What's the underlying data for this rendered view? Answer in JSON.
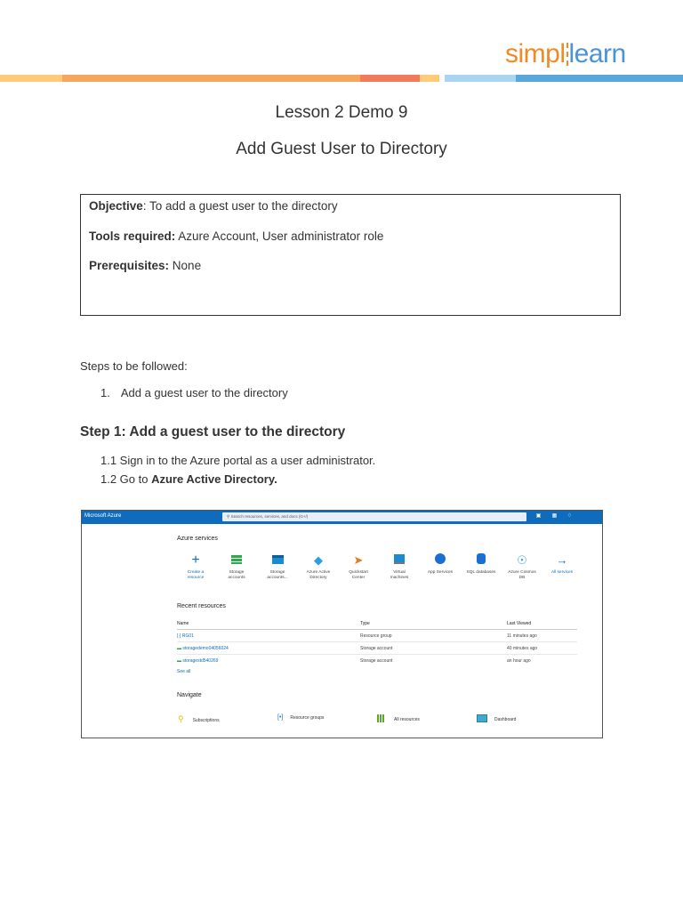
{
  "brand": {
    "logo_part1": "simpl",
    "logo_part2": "learn",
    "colors": {
      "orange": "#f08a24",
      "blue": "#4a93d6",
      "stripe_light": "#ffcb7a",
      "stripe_mid": "#f7a65d",
      "stripe_red": "#f27b5b",
      "stripe_lightblue": "#a9d5f0"
    }
  },
  "lesson_title": "Lesson 2 Demo 9",
  "doc_title": "Add Guest User to Directory",
  "objective_box": {
    "objective_label": "Objective",
    "objective_text": ": To add a guest user to the directory",
    "tools_label": "Tools required:",
    "tools_text": " Azure Account, User administrator role",
    "prereq_label": "Prerequisites:",
    "prereq_text": " None"
  },
  "steps_intro": "Steps to be followed:",
  "steps_list": [
    {
      "num": "1.",
      "text": "Add a guest user to the directory"
    }
  ],
  "step1": {
    "heading": "Step 1: Add a guest user to the directory",
    "line1": "1.1 Sign in to the Azure portal as a user administrator.",
    "line2_prefix": "1.2 Go to ",
    "line2_bold": "Azure Active Directory."
  },
  "portal": {
    "brand": "Microsoft Azure",
    "search_placeholder": "Search resources, services, and docs (G+/)",
    "azure_services_heading": "Azure services",
    "services": [
      {
        "icon": "plus-icon",
        "l1": "Create a",
        "l2": "resource",
        "color": "#0f6cbd"
      },
      {
        "icon": "storage-icon",
        "l1": "Storage",
        "l2": "accounts",
        "color": "#2fa84f"
      },
      {
        "icon": "storage-classic-icon",
        "l1": "Storage",
        "l2": "accounts...",
        "color": "#1b8bd1"
      },
      {
        "icon": "aad-icon",
        "l1": "Azure Active",
        "l2": "Directory",
        "color": "#2f9be0"
      },
      {
        "icon": "rocket-icon",
        "l1": "Quickstart",
        "l2": "Center",
        "color": "#e07b1f"
      },
      {
        "icon": "vm-icon",
        "l1": "Virtual",
        "l2": "machines",
        "color": "#1b8bd1"
      },
      {
        "icon": "app-services-icon",
        "l1": "App Services",
        "l2": "",
        "color": "#1b6fd1"
      },
      {
        "icon": "sql-icon",
        "l1": "SQL databases",
        "l2": "",
        "color": "#1b6fd1"
      },
      {
        "icon": "cosmos-icon",
        "l1": "Azure Cosmos",
        "l2": "DB",
        "color": "#2f9be0"
      },
      {
        "icon": "arrow-right-icon",
        "l1": "All services",
        "l2": "",
        "color": "#0f6cbd"
      }
    ],
    "recent_heading": "Recent resources",
    "columns": [
      "Name",
      "Type",
      "Last Viewed"
    ],
    "rows": [
      {
        "name": "RG01",
        "type": "Resource group",
        "viewed": "11 minutes ago"
      },
      {
        "name": "storagedemo04056024",
        "type": "Storage account",
        "viewed": "40 minutes ago"
      },
      {
        "name": "storagestd540269",
        "type": "Storage account",
        "viewed": "an hour ago"
      }
    ],
    "see_all": "See all",
    "navigate_heading": "Navigate",
    "nav_items": [
      {
        "icon": "key-icon",
        "label": "Subscriptions"
      },
      {
        "icon": "resource-groups-icon",
        "label": "Resource groups"
      },
      {
        "icon": "grid-icon",
        "label": "All resources"
      },
      {
        "icon": "dashboard-icon",
        "label": "Dashboard"
      }
    ]
  }
}
